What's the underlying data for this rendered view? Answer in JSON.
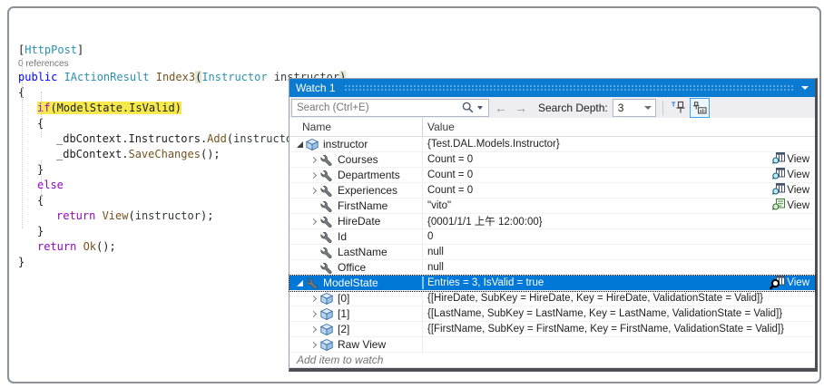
{
  "editor": {
    "codelens": "0 references",
    "lines": [
      {
        "indent": 0,
        "tokens": [
          {
            "t": "[",
            "c": "pl"
          },
          {
            "t": "HttpPost",
            "c": "ty"
          },
          {
            "t": "]",
            "c": "pl"
          }
        ]
      },
      {
        "lens": true
      },
      {
        "indent": 0,
        "tokens": [
          {
            "t": "public ",
            "c": "kw"
          },
          {
            "t": "IActionResult ",
            "c": "ty"
          },
          {
            "t": "Index3",
            "c": "me"
          },
          {
            "t": "(",
            "c": "pl",
            "bg": "mb"
          },
          {
            "t": "Instructor",
            "c": "ty"
          },
          {
            "t": " ",
            "c": "pl"
          },
          {
            "t": "instructor",
            "c": "pr"
          },
          {
            "t": ")",
            "c": "pl",
            "bg": "mb"
          }
        ]
      },
      {
        "indent": 0,
        "tokens": [
          {
            "t": "{",
            "c": "pl"
          }
        ]
      },
      {
        "indent": 1,
        "tokens": [
          {
            "t": "if",
            "c": "ct",
            "bg": "hl"
          },
          {
            "t": "(ModelState.IsValid)",
            "c": "pl",
            "bg": "hl"
          }
        ]
      },
      {
        "indent": 1,
        "tokens": [
          {
            "t": "{",
            "c": "pl"
          }
        ]
      },
      {
        "indent": 2,
        "tokens": [
          {
            "t": "_dbContext.Instructors.",
            "c": "pl"
          },
          {
            "t": "Add",
            "c": "me"
          },
          {
            "t": "(",
            "c": "pl"
          },
          {
            "t": "instructor",
            "c": "pr"
          },
          {
            "t": ");",
            "c": "pl"
          }
        ]
      },
      {
        "indent": 2,
        "tokens": [
          {
            "t": "_dbContext.",
            "c": "pl"
          },
          {
            "t": "SaveChanges",
            "c": "me"
          },
          {
            "t": "();",
            "c": "pl"
          }
        ]
      },
      {
        "indent": 1,
        "tokens": [
          {
            "t": "}",
            "c": "pl"
          }
        ]
      },
      {
        "indent": 1,
        "tokens": [
          {
            "t": "else",
            "c": "ct"
          }
        ]
      },
      {
        "indent": 1,
        "tokens": [
          {
            "t": "{",
            "c": "pl"
          }
        ]
      },
      {
        "indent": 2,
        "tokens": [
          {
            "t": "return ",
            "c": "ct"
          },
          {
            "t": "View",
            "c": "me"
          },
          {
            "t": "(",
            "c": "pl"
          },
          {
            "t": "instructor",
            "c": "pr"
          },
          {
            "t": ");",
            "c": "pl"
          }
        ]
      },
      {
        "indent": 1,
        "tokens": [
          {
            "t": "}",
            "c": "pl"
          }
        ]
      },
      {
        "indent": 1,
        "tokens": [
          {
            "t": "return ",
            "c": "ct"
          },
          {
            "t": "Ok",
            "c": "me"
          },
          {
            "t": "();",
            "c": "pl"
          }
        ]
      },
      {
        "indent": 0,
        "tokens": [
          {
            "t": "}",
            "c": "pl"
          }
        ]
      }
    ],
    "syntax_colors": {
      "keyword": "#0000ff",
      "control": "#8f08c4",
      "type": "#2b91af",
      "method": "#74531f",
      "plain": "#1e1e1e",
      "parameter": "#33383d",
      "codelens": "#767676",
      "find_highlight": "#f6e94e",
      "brace_match": "#e3e8d4"
    }
  },
  "watch": {
    "title": "Watch 1",
    "search": {
      "placeholder": "Search (Ctrl+E)"
    },
    "depth": {
      "label": "Search Depth:",
      "value": "3"
    },
    "columns": {
      "name": "Name",
      "value": "Value"
    },
    "view_label": "View",
    "add_item": "Add item to watch",
    "rows": [
      {
        "level": 0,
        "exp": "open",
        "icon": "obj",
        "name": "instructor",
        "value": "{Test.DAL.Models.Instructor}"
      },
      {
        "level": 1,
        "exp": "closed",
        "icon": "prop",
        "name": "Courses",
        "value": "Count = 0",
        "view": "grid"
      },
      {
        "level": 1,
        "exp": "closed",
        "icon": "prop",
        "name": "Departments",
        "value": "Count = 0",
        "view": "grid"
      },
      {
        "level": 1,
        "exp": "closed",
        "icon": "prop",
        "name": "Experiences",
        "value": "Count = 0",
        "view": "grid"
      },
      {
        "level": 1,
        "exp": "none",
        "icon": "prop",
        "name": "FirstName",
        "value": "\"vito\"",
        "view": "text"
      },
      {
        "level": 1,
        "exp": "closed",
        "icon": "prop",
        "name": "HireDate",
        "value": "{0001/1/1 上午 12:00:00}"
      },
      {
        "level": 1,
        "exp": "none",
        "icon": "prop",
        "name": "Id",
        "value": "0"
      },
      {
        "level": 1,
        "exp": "none",
        "icon": "prop",
        "name": "LastName",
        "value": "null"
      },
      {
        "level": 1,
        "exp": "none",
        "icon": "prop",
        "name": "Office",
        "value": "null"
      },
      {
        "level": 0,
        "exp": "open",
        "icon": "prop",
        "name": "ModelState",
        "value": "Entries = 3, IsValid = true",
        "view": "grid",
        "selected": true,
        "cursor": true
      },
      {
        "level": 1,
        "exp": "closed",
        "icon": "obj",
        "name": "[0]",
        "value": "{[HireDate, SubKey = HireDate, Key = HireDate, ValidationState = Valid]}"
      },
      {
        "level": 1,
        "exp": "closed",
        "icon": "obj",
        "name": "[1]",
        "value": "{[LastName, SubKey = LastName, Key = LastName, ValidationState = Valid]}"
      },
      {
        "level": 1,
        "exp": "closed",
        "icon": "obj",
        "name": "[2]",
        "value": "{[FirstName, SubKey = FirstName, Key = FirstName, ValidationState = Valid]}"
      },
      {
        "level": 1,
        "exp": "closed",
        "icon": "obj",
        "name": "Raw View",
        "value": ""
      }
    ],
    "colors": {
      "titlebar": "#0b7bd1",
      "selection": "#0078d7",
      "toolbar_bg": "#eeeef2"
    }
  }
}
